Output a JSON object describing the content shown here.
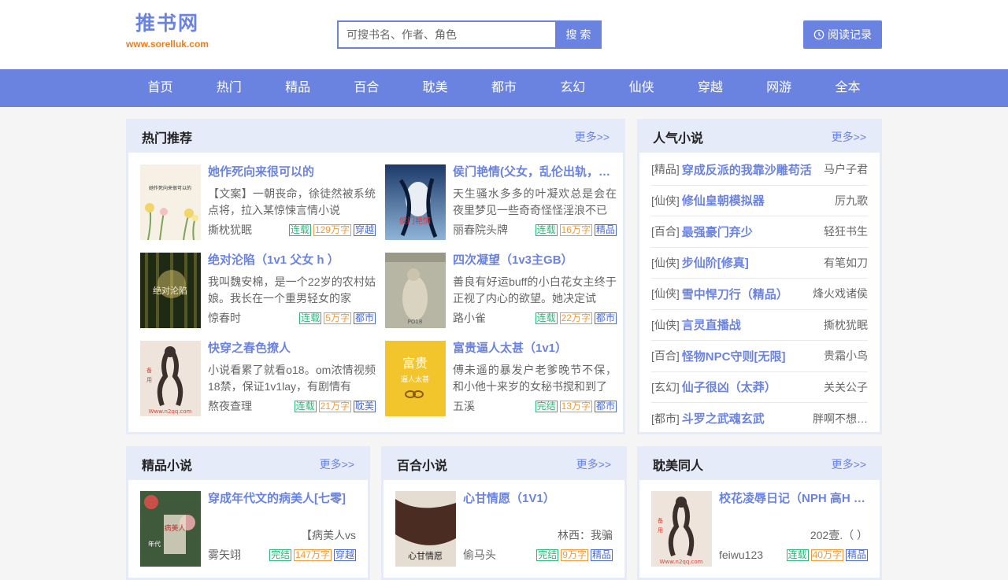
{
  "header": {
    "logo_title": "推书网",
    "logo_url": "www.sorelluk.com",
    "search_placeholder": "可搜书名、作者、角色",
    "search_button": "搜 索",
    "history_button": "阅读记录"
  },
  "nav": [
    "首页",
    "热门",
    "精品",
    "百合",
    "耽美",
    "都市",
    "玄幻",
    "仙侠",
    "穿越",
    "网游",
    "全本"
  ],
  "hot": {
    "title": "热门推荐",
    "more": "更多>>",
    "books": [
      {
        "title": "她作死向来很可以的",
        "desc": "【文案】一朝丧命，徐徒然被系统点将，拉入某惊悚言情小说",
        "author": "撕枕犹眠",
        "tags": [
          "连载",
          "129万字",
          "穿越"
        ]
      },
      {
        "title": "侯门艳情(父女，乱伦出轨，…",
        "desc": "天生骚水多多的叶凝欢总是会在夜里梦见一些奇奇怪怪淫浪不已",
        "author": "丽春院头牌",
        "tags": [
          "连载",
          "16万字",
          "精品"
        ]
      },
      {
        "title": "绝对沦陷（1v1 父女 h ）",
        "desc": "我叫魏安棉，是一个22岁的农村姑娘。我长在一个重男轻女的家",
        "author": "惊春时",
        "tags": [
          "连载",
          "5万字",
          "都市"
        ]
      },
      {
        "title": "四次凝望（1v3主GB）",
        "desc": "善良有好运buff的小白花女主终于正视了内心的欲望。她决定试",
        "author": "路小雀",
        "tags": [
          "连载",
          "22万字",
          "都市"
        ]
      },
      {
        "title": "快穿之春色撩人",
        "desc": "小说看累了就看o18。om浓情视频18禁，保证1v1lay，有剧情有",
        "author": "熬夜查理",
        "tags": [
          "连载",
          "21万字",
          "耽美"
        ]
      },
      {
        "title": "富贵逼人太甚（1v1）",
        "desc": "傅未遥的暴发户老爹晚节不保，和小他十来岁的女秘书搅和到了",
        "author": "五溪",
        "tags": [
          "完结",
          "13万字",
          "都市"
        ]
      }
    ]
  },
  "popular": {
    "title": "人气小说",
    "more": "更多>>",
    "items": [
      {
        "cat": "[精品]",
        "title": "穿成反派的我靠沙雕苟活",
        "author": "马户子君"
      },
      {
        "cat": "[仙侠]",
        "title": "修仙皇朝模拟器",
        "author": "厉九歌"
      },
      {
        "cat": "[百合]",
        "title": "最强豪门弃少",
        "author": "轻狂书生"
      },
      {
        "cat": "[仙侠]",
        "title": "步仙阶[修真]",
        "author": "有笔如刀"
      },
      {
        "cat": "[仙侠]",
        "title": "雪中悍刀行（精品）",
        "author": "烽火戏诸侯"
      },
      {
        "cat": "[仙侠]",
        "title": "言灵直播战",
        "author": "撕枕犹眠"
      },
      {
        "cat": "[百合]",
        "title": "怪物NPC守则[无限]",
        "author": "贵霜小鸟"
      },
      {
        "cat": "[玄幻]",
        "title": "仙子很凶（太莽）",
        "author": "关关公子"
      },
      {
        "cat": "[都市]",
        "title": "斗罗之武魂玄武",
        "author": "胖啊不想…"
      }
    ]
  },
  "bottom": [
    {
      "title": "精品小说",
      "more": "更多>>",
      "book": {
        "title": "穿成年代文的病美人[七零]",
        "desc": "【病美人vs",
        "author": "雾矢翊",
        "tags": [
          "完结",
          "147万字",
          "穿越"
        ]
      }
    },
    {
      "title": "百合小说",
      "more": "更多>>",
      "book": {
        "title": "心甘情愿（1V1）",
        "desc": "林西：我骗",
        "author": "偷马头",
        "tags": [
          "完结",
          "9万字",
          "精品"
        ]
      }
    },
    {
      "title": "耽美同人",
      "more": "更多>>",
      "book": {
        "title": "校花凌辱日记（NPH 高H …",
        "desc": "202壹.（ ）",
        "author": "feiwu123",
        "tags": [
          "连载",
          "40万字",
          "精品"
        ]
      }
    }
  ],
  "colors": {
    "accent": "#6b83e0",
    "panel_head": "#e6ebf9",
    "logo_url": "#ef7f1a"
  }
}
